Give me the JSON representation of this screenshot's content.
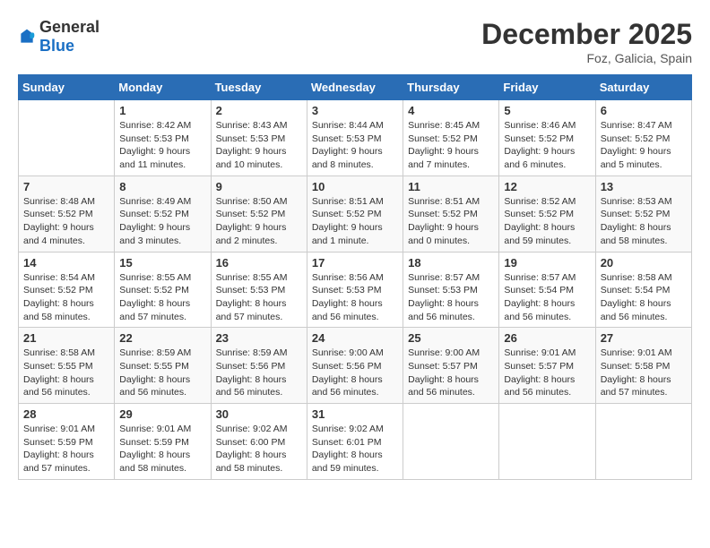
{
  "header": {
    "logo_general": "General",
    "logo_blue": "Blue",
    "month": "December 2025",
    "location": "Foz, Galicia, Spain"
  },
  "weekdays": [
    "Sunday",
    "Monday",
    "Tuesday",
    "Wednesday",
    "Thursday",
    "Friday",
    "Saturday"
  ],
  "weeks": [
    [
      {
        "day": "",
        "info": ""
      },
      {
        "day": "1",
        "info": "Sunrise: 8:42 AM\nSunset: 5:53 PM\nDaylight: 9 hours\nand 11 minutes."
      },
      {
        "day": "2",
        "info": "Sunrise: 8:43 AM\nSunset: 5:53 PM\nDaylight: 9 hours\nand 10 minutes."
      },
      {
        "day": "3",
        "info": "Sunrise: 8:44 AM\nSunset: 5:53 PM\nDaylight: 9 hours\nand 8 minutes."
      },
      {
        "day": "4",
        "info": "Sunrise: 8:45 AM\nSunset: 5:52 PM\nDaylight: 9 hours\nand 7 minutes."
      },
      {
        "day": "5",
        "info": "Sunrise: 8:46 AM\nSunset: 5:52 PM\nDaylight: 9 hours\nand 6 minutes."
      },
      {
        "day": "6",
        "info": "Sunrise: 8:47 AM\nSunset: 5:52 PM\nDaylight: 9 hours\nand 5 minutes."
      }
    ],
    [
      {
        "day": "7",
        "info": "Sunrise: 8:48 AM\nSunset: 5:52 PM\nDaylight: 9 hours\nand 4 minutes."
      },
      {
        "day": "8",
        "info": "Sunrise: 8:49 AM\nSunset: 5:52 PM\nDaylight: 9 hours\nand 3 minutes."
      },
      {
        "day": "9",
        "info": "Sunrise: 8:50 AM\nSunset: 5:52 PM\nDaylight: 9 hours\nand 2 minutes."
      },
      {
        "day": "10",
        "info": "Sunrise: 8:51 AM\nSunset: 5:52 PM\nDaylight: 9 hours\nand 1 minute."
      },
      {
        "day": "11",
        "info": "Sunrise: 8:51 AM\nSunset: 5:52 PM\nDaylight: 9 hours\nand 0 minutes."
      },
      {
        "day": "12",
        "info": "Sunrise: 8:52 AM\nSunset: 5:52 PM\nDaylight: 8 hours\nand 59 minutes."
      },
      {
        "day": "13",
        "info": "Sunrise: 8:53 AM\nSunset: 5:52 PM\nDaylight: 8 hours\nand 58 minutes."
      }
    ],
    [
      {
        "day": "14",
        "info": "Sunrise: 8:54 AM\nSunset: 5:52 PM\nDaylight: 8 hours\nand 58 minutes."
      },
      {
        "day": "15",
        "info": "Sunrise: 8:55 AM\nSunset: 5:52 PM\nDaylight: 8 hours\nand 57 minutes."
      },
      {
        "day": "16",
        "info": "Sunrise: 8:55 AM\nSunset: 5:53 PM\nDaylight: 8 hours\nand 57 minutes."
      },
      {
        "day": "17",
        "info": "Sunrise: 8:56 AM\nSunset: 5:53 PM\nDaylight: 8 hours\nand 56 minutes."
      },
      {
        "day": "18",
        "info": "Sunrise: 8:57 AM\nSunset: 5:53 PM\nDaylight: 8 hours\nand 56 minutes."
      },
      {
        "day": "19",
        "info": "Sunrise: 8:57 AM\nSunset: 5:54 PM\nDaylight: 8 hours\nand 56 minutes."
      },
      {
        "day": "20",
        "info": "Sunrise: 8:58 AM\nSunset: 5:54 PM\nDaylight: 8 hours\nand 56 minutes."
      }
    ],
    [
      {
        "day": "21",
        "info": "Sunrise: 8:58 AM\nSunset: 5:55 PM\nDaylight: 8 hours\nand 56 minutes."
      },
      {
        "day": "22",
        "info": "Sunrise: 8:59 AM\nSunset: 5:55 PM\nDaylight: 8 hours\nand 56 minutes."
      },
      {
        "day": "23",
        "info": "Sunrise: 8:59 AM\nSunset: 5:56 PM\nDaylight: 8 hours\nand 56 minutes."
      },
      {
        "day": "24",
        "info": "Sunrise: 9:00 AM\nSunset: 5:56 PM\nDaylight: 8 hours\nand 56 minutes."
      },
      {
        "day": "25",
        "info": "Sunrise: 9:00 AM\nSunset: 5:57 PM\nDaylight: 8 hours\nand 56 minutes."
      },
      {
        "day": "26",
        "info": "Sunrise: 9:01 AM\nSunset: 5:57 PM\nDaylight: 8 hours\nand 56 minutes."
      },
      {
        "day": "27",
        "info": "Sunrise: 9:01 AM\nSunset: 5:58 PM\nDaylight: 8 hours\nand 57 minutes."
      }
    ],
    [
      {
        "day": "28",
        "info": "Sunrise: 9:01 AM\nSunset: 5:59 PM\nDaylight: 8 hours\nand 57 minutes."
      },
      {
        "day": "29",
        "info": "Sunrise: 9:01 AM\nSunset: 5:59 PM\nDaylight: 8 hours\nand 58 minutes."
      },
      {
        "day": "30",
        "info": "Sunrise: 9:02 AM\nSunset: 6:00 PM\nDaylight: 8 hours\nand 58 minutes."
      },
      {
        "day": "31",
        "info": "Sunrise: 9:02 AM\nSunset: 6:01 PM\nDaylight: 8 hours\nand 59 minutes."
      },
      {
        "day": "",
        "info": ""
      },
      {
        "day": "",
        "info": ""
      },
      {
        "day": "",
        "info": ""
      }
    ]
  ]
}
